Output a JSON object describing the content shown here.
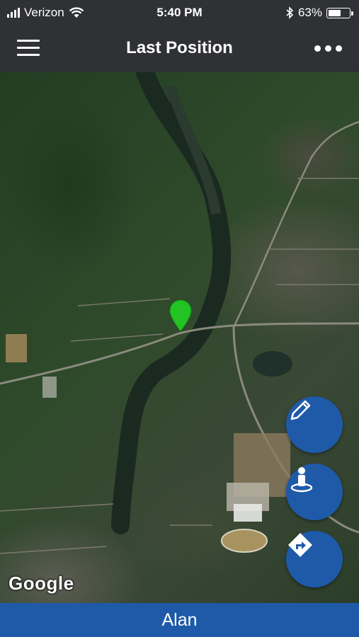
{
  "status_bar": {
    "carrier": "Verizon",
    "time": "5:40 PM",
    "battery": "63%",
    "battery_level": 0.63
  },
  "nav": {
    "title": "Last Position"
  },
  "map": {
    "attribution": "Google",
    "marker_color": "#22c322"
  },
  "footer": {
    "name": "Alan"
  },
  "colors": {
    "nav_bg": "#2f3135",
    "accent": "#1e5aa8"
  },
  "icons": [
    "menu-icon",
    "more-icon",
    "edit-icon",
    "street-view-icon",
    "directions-icon",
    "bluetooth-icon",
    "wifi-icon",
    "battery-icon",
    "signal-icon"
  ]
}
